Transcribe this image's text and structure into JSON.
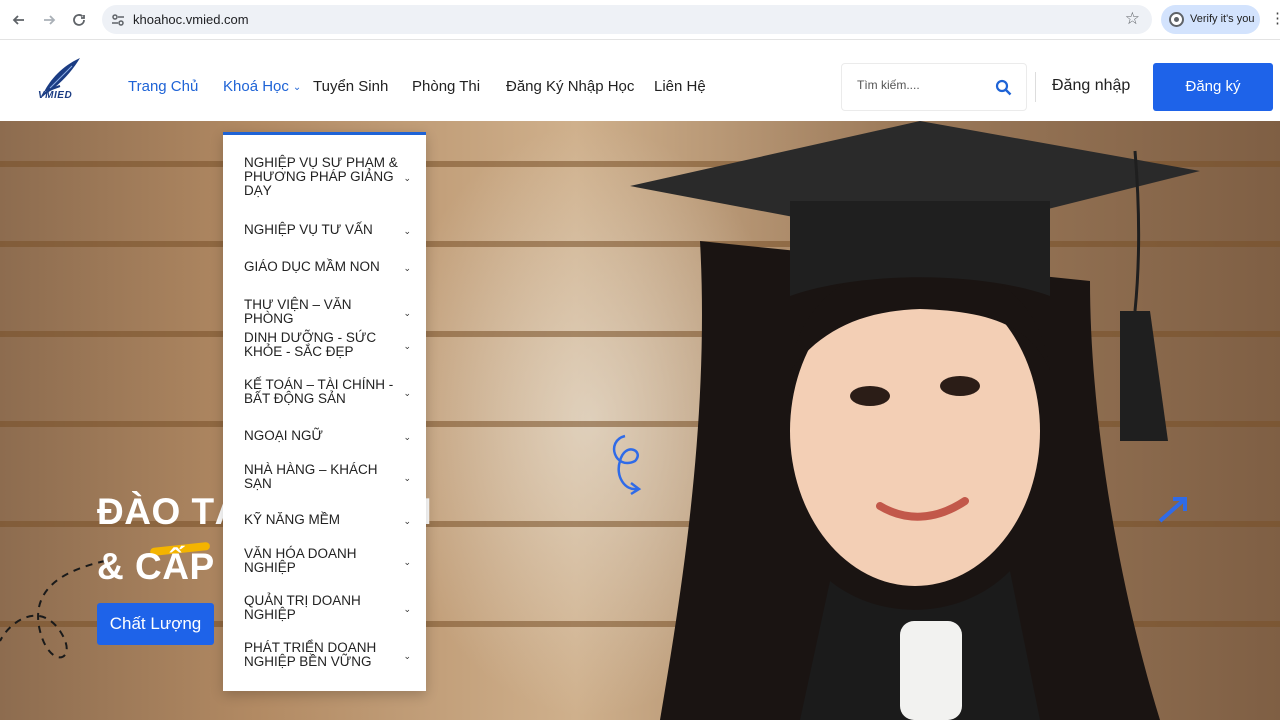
{
  "browser": {
    "url": "khoahoc.vmied.com",
    "verify_label": "Verify it's you"
  },
  "site": {
    "logo_text": "VMIED",
    "menu": [
      {
        "label": "Trang Chủ"
      },
      {
        "label": "Khoá Học"
      },
      {
        "label": "Tuyển Sinh"
      },
      {
        "label": "Phòng Thi"
      },
      {
        "label": "Đăng Ký Nhập Học"
      },
      {
        "label": "Liên Hệ"
      }
    ],
    "search_placeholder": "Tìm kiếm....",
    "login_label": "Đăng nhập",
    "register_label": "Đăng ký"
  },
  "hero": {
    "line1": "ĐÀO TẠ",
    "line1_tail": "N",
    "line2": "& CẤP C",
    "button_label": "Chất Lượng"
  },
  "dropdown": {
    "items": [
      {
        "label": "NGHIỆP VỤ SƯ PHẠM & PHƯƠNG PHÁP GIẢNG DẠY"
      },
      {
        "label": "NGHIỆP VỤ TƯ VẤN"
      },
      {
        "label": "GIÁO DỤC MẦM NON"
      },
      {
        "label": "THƯ VIỆN – VĂN PHÒNG"
      },
      {
        "label": "DINH DƯỠNG - SỨC KHỎE - SẮC ĐẸP"
      },
      {
        "label": "KẾ TOÁN – TÀI CHÍNH - BẤT ĐỘNG SẢN"
      },
      {
        "label": "NGOẠI NGỮ"
      },
      {
        "label": "NHÀ HÀNG – KHÁCH SẠN"
      },
      {
        "label": "KỸ NĂNG MỀM"
      },
      {
        "label": "VĂN HÓA DOANH NGHIỆP"
      },
      {
        "label": "QUẢN TRỊ DOANH NGHIỆP"
      },
      {
        "label": "PHÁT TRIỂN DOANH NGHIỆP BỀN VỮNG"
      }
    ]
  },
  "colors": {
    "accent": "#1e63e9",
    "active_menu": "#1e63d6"
  }
}
